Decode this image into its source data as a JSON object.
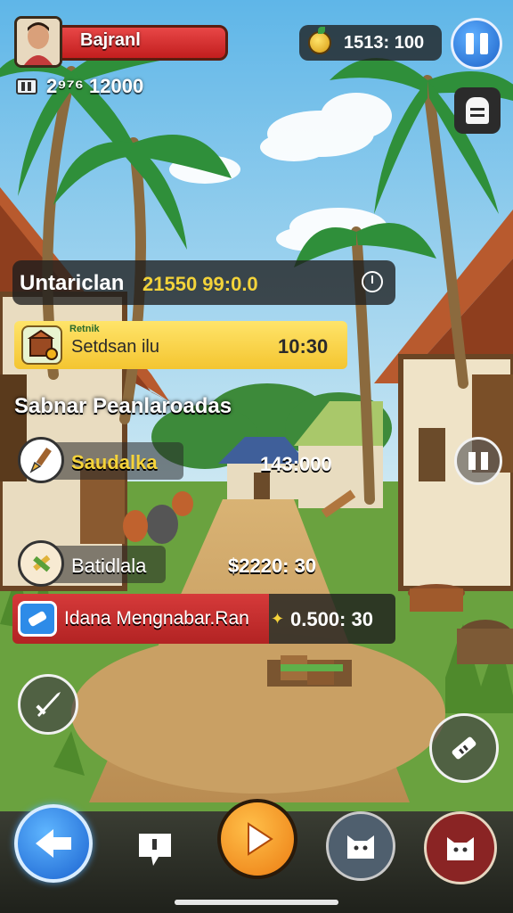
{
  "player": {
    "name": "Bajranl",
    "coins": "2⁹⁷⁶ 12000"
  },
  "resources": {
    "amount": "1513: 100"
  },
  "banner": {
    "title": "Untariclan",
    "value": "21550 99:0.0"
  },
  "quest": {
    "tag": "Retnik",
    "label": "Setdsan ilu",
    "timer": "10:30"
  },
  "section": {
    "title": "Sabnar Peanlaroadas"
  },
  "items": [
    {
      "label": "Saudalka",
      "value": "143:000"
    },
    {
      "label": "Batidlala",
      "value": "$2220: 30"
    },
    {
      "label": "Idana Mengnabar.Ran",
      "value": "0.500: 30"
    }
  ],
  "colors": {
    "accent_red": "#d62a2a",
    "accent_orange": "#f79a1c",
    "accent_blue": "#2f86e8",
    "accent_yellow": "#f6d23a"
  },
  "icons": {
    "pause": "pause-icon",
    "notice": "notice-icon",
    "back": "back-arrow-icon",
    "chat": "chat-icon",
    "play": "play-icon",
    "pet1": "pet-icon",
    "pet2": "pet-icon"
  }
}
